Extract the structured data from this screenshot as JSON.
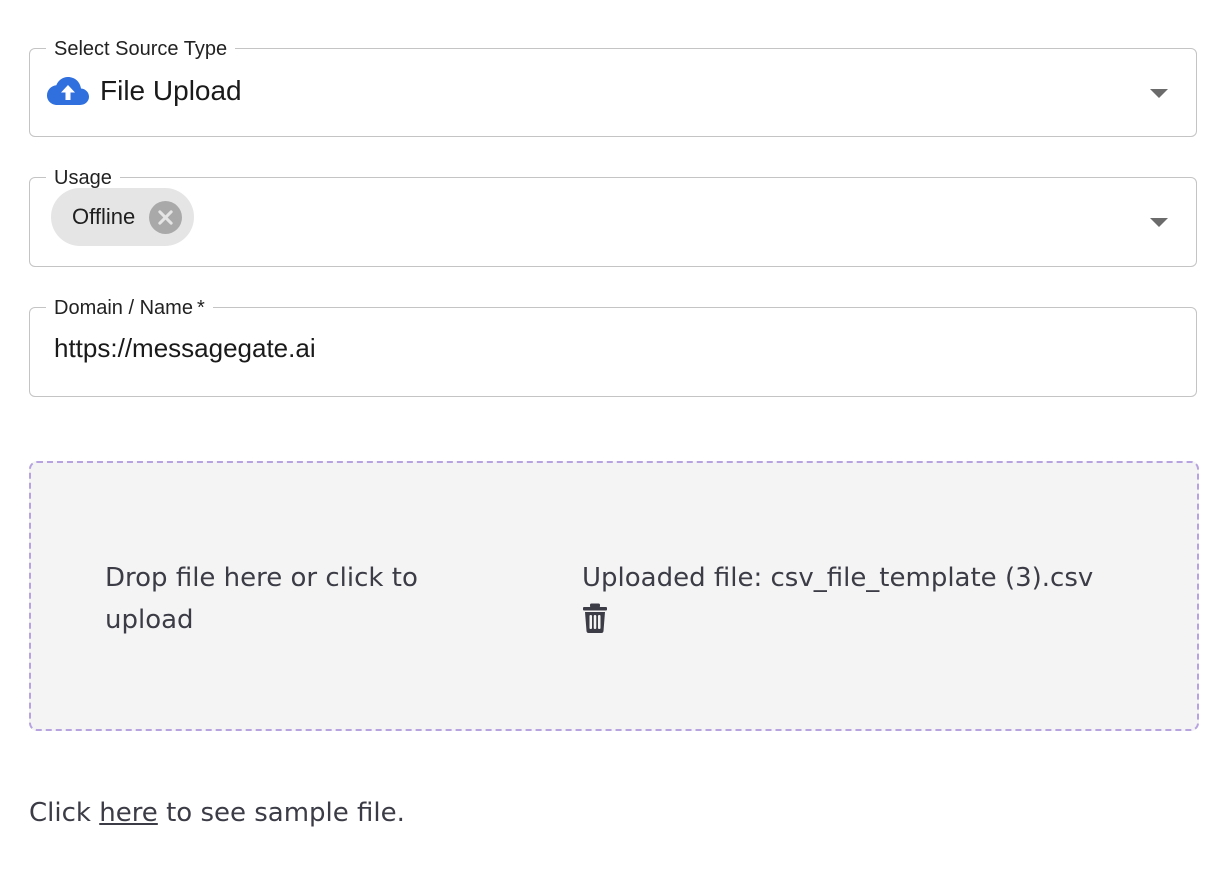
{
  "source_type": {
    "label": "Select Source Type",
    "value": "File Upload",
    "icon": "cloud-upload-icon",
    "icon_color": "#2f6fde"
  },
  "usage": {
    "label": "Usage",
    "chips": [
      {
        "label": "Offline"
      }
    ]
  },
  "domain": {
    "label": "Domain / Name",
    "required_marker": "*",
    "value": "https://messagegate.ai"
  },
  "upload": {
    "prompt": "Drop file here or click to upload",
    "uploaded_file": "Uploaded file: csv_file_template (3).csv",
    "delete_icon": "trash-icon",
    "border_color": "#b7a3df"
  },
  "sample": {
    "prefix": "Click",
    "link": "here",
    "suffix": "to see sample file."
  }
}
